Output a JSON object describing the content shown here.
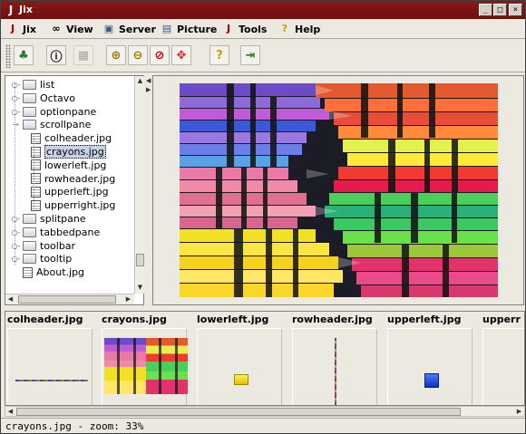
{
  "window": {
    "title": "Jix",
    "min": "_",
    "max": "□",
    "close": "×"
  },
  "menu": [
    {
      "label": "Jix",
      "icon": "J"
    },
    {
      "label": "View",
      "icon": "∞"
    },
    {
      "label": "Server",
      "icon": "▣"
    },
    {
      "label": "Picture",
      "icon": "▤"
    },
    {
      "label": "Tools",
      "icon": "J"
    },
    {
      "label": "Help",
      "icon": "?"
    }
  ],
  "toolbar": [
    {
      "name": "tree-icon",
      "glyph": "♣",
      "color": "#2b7a2b",
      "enabled": true
    },
    {
      "name": "info-icon",
      "glyph": "ⓘ",
      "color": "#000",
      "enabled": true
    },
    {
      "name": "server-icon",
      "glyph": "▦",
      "color": "#555",
      "enabled": false
    },
    {
      "name": "zoom-in-icon",
      "glyph": "⊕",
      "color": "#a07800",
      "enabled": true
    },
    {
      "name": "zoom-out-icon",
      "glyph": "⊖",
      "color": "#a07800",
      "enabled": true
    },
    {
      "name": "zoom-reset-icon",
      "glyph": "⊘",
      "color": "#c00000",
      "enabled": true
    },
    {
      "name": "fit-icon",
      "glyph": "✥",
      "color": "#c03030",
      "enabled": true
    },
    {
      "name": "help-icon",
      "glyph": "?",
      "color": "#c8a000",
      "enabled": true
    },
    {
      "name": "exit-icon",
      "glyph": "⇥",
      "color": "#2b7a2b",
      "enabled": true
    }
  ],
  "tree": [
    {
      "label": "list",
      "type": "folder",
      "indent": 0,
      "expanded": false
    },
    {
      "label": "Octavo",
      "type": "folder",
      "indent": 0,
      "expanded": false
    },
    {
      "label": "optionpane",
      "type": "folder",
      "indent": 0,
      "expanded": false
    },
    {
      "label": "scrollpane",
      "type": "folder",
      "indent": 0,
      "expanded": true
    },
    {
      "label": "colheader.jpg",
      "type": "file",
      "indent": 1
    },
    {
      "label": "crayons.jpg",
      "type": "file",
      "indent": 1,
      "selected": true
    },
    {
      "label": "lowerleft.jpg",
      "type": "file",
      "indent": 1
    },
    {
      "label": "rowheader.jpg",
      "type": "file",
      "indent": 1
    },
    {
      "label": "upperleft.jpg",
      "type": "file",
      "indent": 1
    },
    {
      "label": "upperright.jpg",
      "type": "file",
      "indent": 1
    },
    {
      "label": "splitpane",
      "type": "folder",
      "indent": 0,
      "expanded": false
    },
    {
      "label": "tabbedpane",
      "type": "folder",
      "indent": 0,
      "expanded": false
    },
    {
      "label": "toolbar",
      "type": "folder",
      "indent": 0,
      "expanded": false
    },
    {
      "label": "tooltip",
      "type": "folder",
      "indent": 0,
      "expanded": false
    },
    {
      "label": "About.jpg",
      "type": "file",
      "indent": 0
    }
  ],
  "thumbnails": [
    {
      "label": "colheader.jpg",
      "kind": "hline"
    },
    {
      "label": "crayons.jpg",
      "kind": "crayons"
    },
    {
      "label": "lowerleft.jpg",
      "kind": "yellow"
    },
    {
      "label": "rowheader.jpg",
      "kind": "vline"
    },
    {
      "label": "upperleft.jpg",
      "kind": "blue"
    },
    {
      "label": "upperr",
      "kind": "none"
    }
  ],
  "status": "crayons.jpg - zoom: 33%"
}
